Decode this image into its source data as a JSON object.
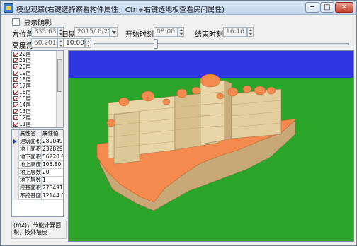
{
  "window": {
    "title": "模型观察(右键选择察看构件属性，Ctrl+右键选地板查看房间属性)",
    "minimize_label": "─",
    "maximize_label": "□",
    "close_label": "✕"
  },
  "toolbar": {
    "show_shadow_label": "显示阴影",
    "azimuth_label": "方位角",
    "azimuth_value": "335.633",
    "elevation_label": "高度角",
    "elevation_value": "60.2015",
    "date_label": "日期",
    "date_value": "2015/ 6/22",
    "start_time_label": "开始时刻",
    "start_time_value": "08:00",
    "end_time_label": "结束时刻",
    "end_time_value": "16:16",
    "current_time_value": "10:00"
  },
  "floors": {
    "items": [
      "22层",
      "21层",
      "20层",
      "19层",
      "18层",
      "17层",
      "16层",
      "15层",
      "14层",
      "13层",
      "12层",
      "11层"
    ]
  },
  "properties": {
    "headers": [
      "属性名",
      "属性值"
    ],
    "rows": [
      {
        "name": "建筑面积",
        "value": "289049.9"
      },
      {
        "name": "地上面积",
        "value": "232829.9"
      },
      {
        "name": "地下面积",
        "value": "56220.0"
      },
      {
        "name": "地上高度",
        "value": "105.80"
      },
      {
        "name": "地上层数",
        "value": "20"
      },
      {
        "name": "地下层数",
        "value": "1"
      },
      {
        "name": "挖基面积",
        "value": "275491.9"
      },
      {
        "name": "不挖基面",
        "value": "12144.0"
      }
    ]
  },
  "note": "(m2)，节能计算面积，按外墙皮",
  "colors": {
    "sky": "#2d36e0",
    "ground": "#2aa52a",
    "wall": "#e8d5a8",
    "roof": "#f48a4e"
  }
}
